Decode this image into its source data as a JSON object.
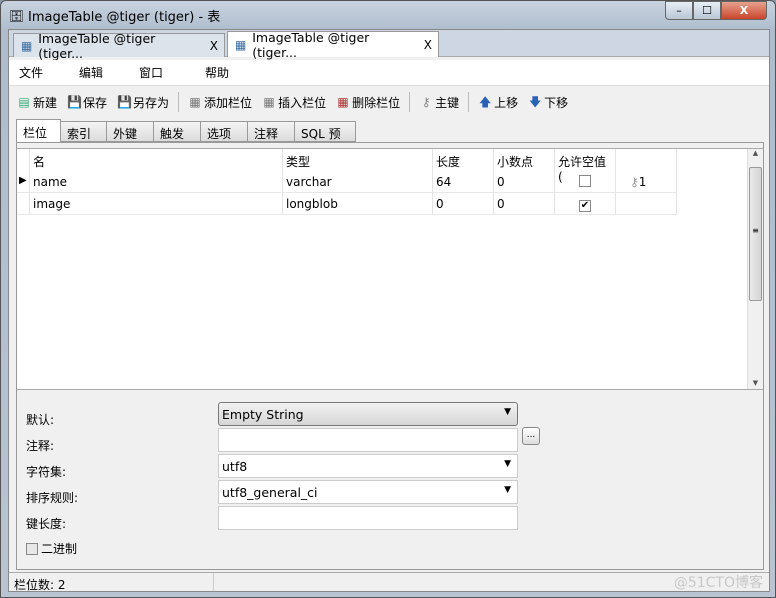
{
  "window": {
    "title": "ImageTable @tiger (tiger) - 表",
    "minimize": "–",
    "maximize": "☐",
    "close": "X"
  },
  "doc_tabs": [
    {
      "label": "ImageTable @tiger (tiger...",
      "close": "X",
      "active": false
    },
    {
      "label": "ImageTable @tiger (tiger...",
      "close": "X",
      "active": true
    }
  ],
  "menu": [
    "文件",
    "编辑",
    "窗口",
    "帮助"
  ],
  "toolbar": {
    "new": "新建",
    "save": "保存",
    "save_as": "另存为",
    "add_field": "添加栏位",
    "insert_field": "插入栏位",
    "delete_field": "删除栏位",
    "primary_key": "主键",
    "move_up": "上移",
    "move_down": "下移"
  },
  "inner_tabs": [
    "栏位",
    "索引",
    "外键",
    "触发器",
    "选项",
    "注释",
    "SQL 预览"
  ],
  "grid": {
    "columns": [
      "名",
      "类型",
      "长度",
      "小数点",
      "允许空值 (",
      ""
    ],
    "rows": [
      {
        "name": "name",
        "type": "varchar",
        "length": "64",
        "decimals": "0",
        "nullable": false,
        "key": "1",
        "selected": true
      },
      {
        "name": "image",
        "type": "longblob",
        "length": "0",
        "decimals": "0",
        "nullable": true,
        "key": "",
        "selected": false
      }
    ]
  },
  "form": {
    "default_label": "默认:",
    "default_value": "Empty String",
    "comment_label": "注释:",
    "comment_value": "",
    "ellipsis": "...",
    "charset_label": "字符集:",
    "charset_value": "utf8",
    "collation_label": "排序规则:",
    "collation_value": "utf8_general_ci",
    "key_length_label": "键长度:",
    "key_length_value": "",
    "binary_label": "二进制",
    "binary_checked": false
  },
  "status": {
    "field_count": "栏位数: 2"
  },
  "watermark": "@51CTO博客"
}
